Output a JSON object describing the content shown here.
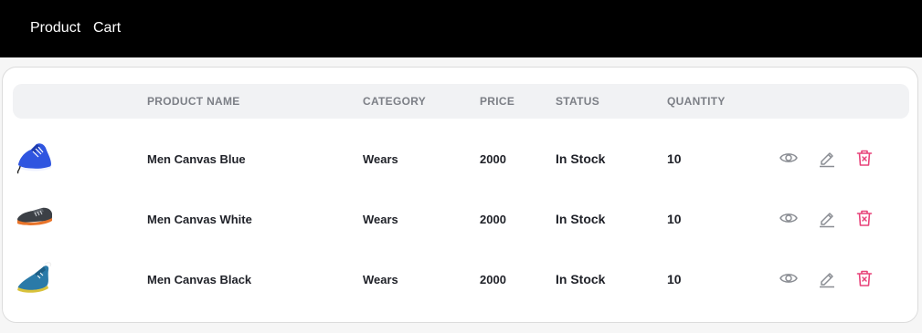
{
  "nav": {
    "links": [
      "Product",
      "Cart"
    ]
  },
  "table": {
    "headers": [
      "PRODUCT NAME",
      "CATEGORY",
      "PRICE",
      "STATUS",
      "QUANTITY"
    ],
    "rows": [
      {
        "image_icon": "blue-shoe-image",
        "name": "Men Canvas Blue",
        "category": "Wears",
        "price": "2000",
        "status": "In Stock",
        "quantity": "10"
      },
      {
        "image_icon": "grey-shoe-image",
        "name": "Men Canvas White",
        "category": "Wears",
        "price": "2000",
        "status": "In Stock",
        "quantity": "10"
      },
      {
        "image_icon": "teal-shoe-image",
        "name": "Men Canvas Black",
        "category": "Wears",
        "price": "2000",
        "status": "In Stock",
        "quantity": "10"
      }
    ],
    "actions": [
      "eye-icon",
      "pencil-icon",
      "trash-icon"
    ]
  },
  "colors": {
    "nav_bg": "#000000",
    "header_bg": "#f1f2f4",
    "icon_grey": "#8a8d93",
    "delete_pink": "#e8437a"
  }
}
